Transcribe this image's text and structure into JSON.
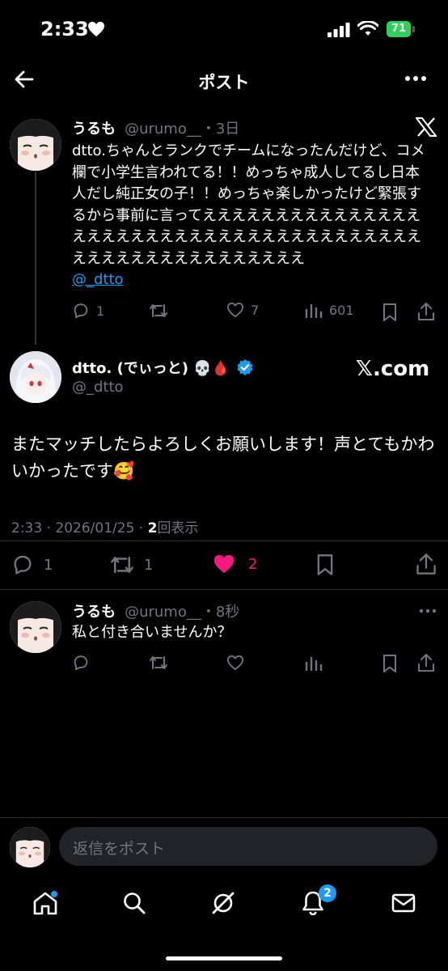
{
  "status_bar": {
    "time": "2:33",
    "battery": "71"
  },
  "header": {
    "title": "ポスト"
  },
  "parent_post": {
    "name": "うるも",
    "handle": "@urumo__",
    "age": "・3日",
    "text": "dtto.ちゃんとランクでチームになったんだけど、コメ欄で小学生言われてる！！めっちゃ成人してるし日本人だし純正女の子！！めっちゃ楽しかったけど緊張するから事前に言ってえええええええええええええええええええええええええええええええええええええええええええええええええええええええ",
    "mention": "@_dtto",
    "replies": "1",
    "likes": "7",
    "views": "601"
  },
  "main_post": {
    "name": "dtto. (でぃっと) 💀🩸",
    "handle": "@_dtto",
    "watermark": "𝕏.com",
    "text": "またマッチしたらよろしくお願いします！声とてもかわいかったです🥰",
    "meta_prefix": "2:33 · 2026/01/25 · ",
    "views_count": "2",
    "views_label": "回表示",
    "replies": "1",
    "reposts": "1",
    "likes": "2"
  },
  "reply_post": {
    "name": "うるも",
    "handle": "@urumo__",
    "age": "・8秒",
    "text": "私と付き合いませんか？"
  },
  "composer": {
    "placeholder": "返信をポスト"
  },
  "tabbar": {
    "notification_badge": "2"
  },
  "colors": {
    "accent": "#1d9bf0",
    "like": "#f91880",
    "muted": "#71767b",
    "battery": "#30d158"
  }
}
